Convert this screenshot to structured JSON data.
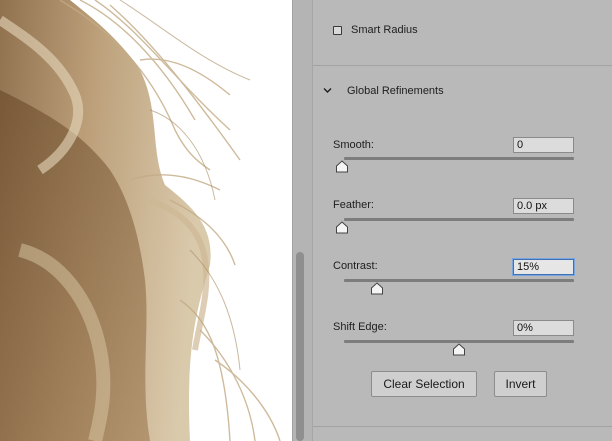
{
  "panel": {
    "smart_radius": {
      "label": "Smart Radius",
      "checked": false
    },
    "global_refinements": {
      "label": "Global Refinements",
      "expanded": true
    },
    "sliders": [
      {
        "key": "smooth",
        "label": "Smooth:",
        "value": "0",
        "position": 0.0,
        "focused": false
      },
      {
        "key": "feather",
        "label": "Feather:",
        "value": "0.0 px",
        "position": 0.0,
        "focused": false
      },
      {
        "key": "contrast",
        "label": "Contrast:",
        "value": "15%",
        "position": 0.15,
        "focused": true
      },
      {
        "key": "shift-edge",
        "label": "Shift Edge:",
        "value": "0%",
        "position": 0.5,
        "focused": false
      }
    ],
    "buttons": {
      "clear_selection": "Clear Selection",
      "invert": "Invert"
    }
  },
  "colors": {
    "panel_bg": "#b9b9b9",
    "focus_ring": "#3f6fb4",
    "canvas_bg": "#ffffff"
  }
}
